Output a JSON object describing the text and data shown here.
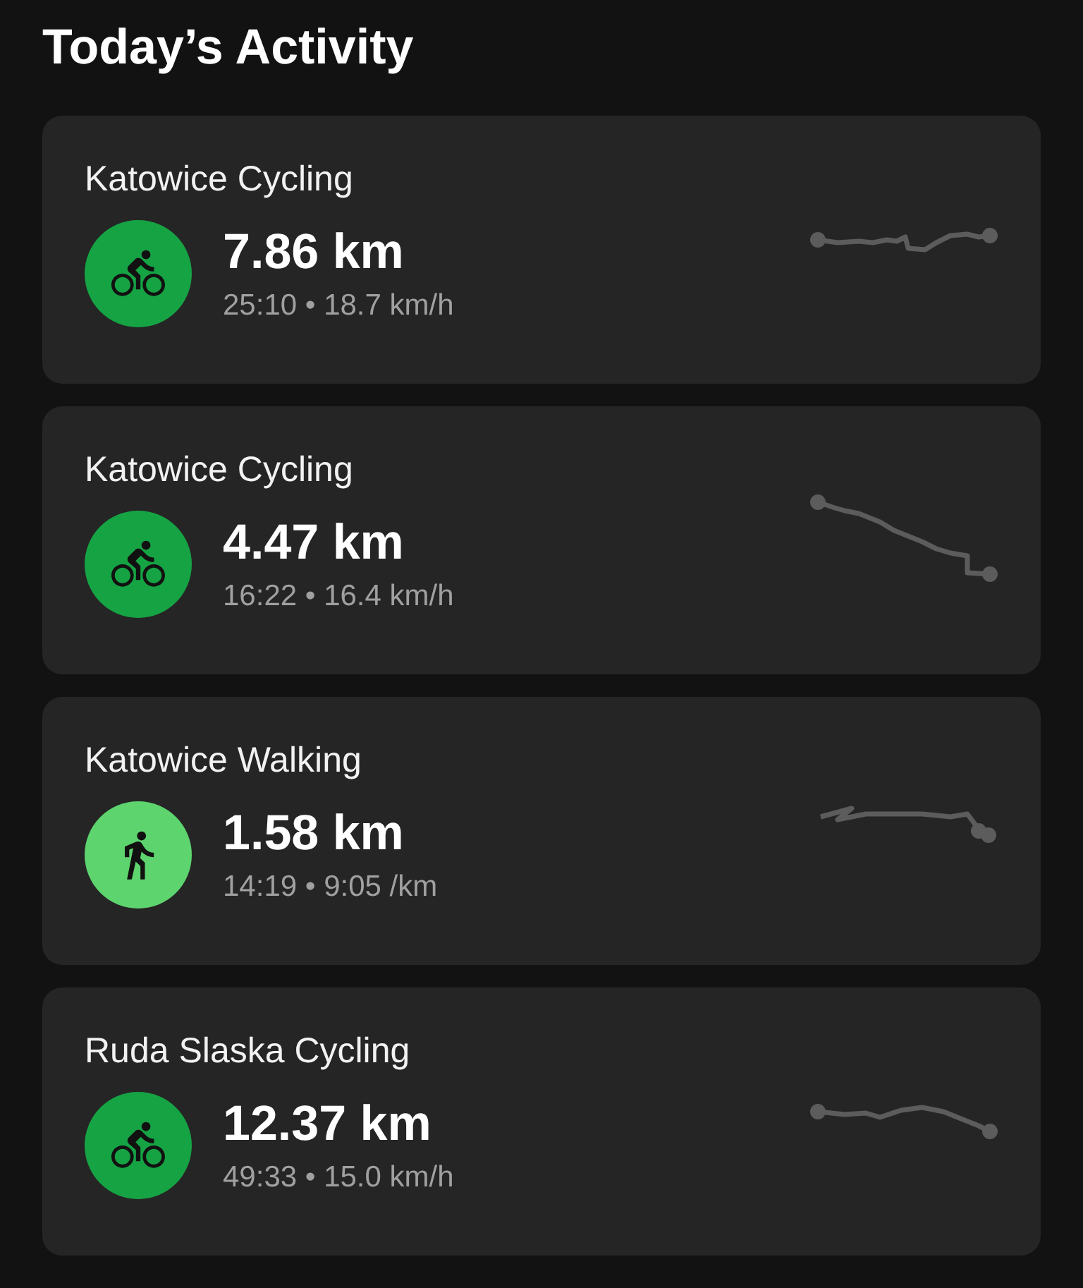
{
  "title": "Today’s Activity",
  "activities": [
    {
      "name": "Katowice Cycling",
      "kind": "cycling",
      "distance": "7.86 km",
      "details": "25:10 • 18.7 km/h"
    },
    {
      "name": "Katowice Cycling",
      "kind": "cycling",
      "distance": "4.47 km",
      "details": "16:22 • 16.4 km/h"
    },
    {
      "name": "Katowice Walking",
      "kind": "walking",
      "distance": "1.58 km",
      "details": "14:19 • 9:05 /km"
    },
    {
      "name": "Ruda Slaska Cycling",
      "kind": "cycling",
      "distance": "12.37 km",
      "details": "49:33 • 15.0 km/h"
    }
  ]
}
